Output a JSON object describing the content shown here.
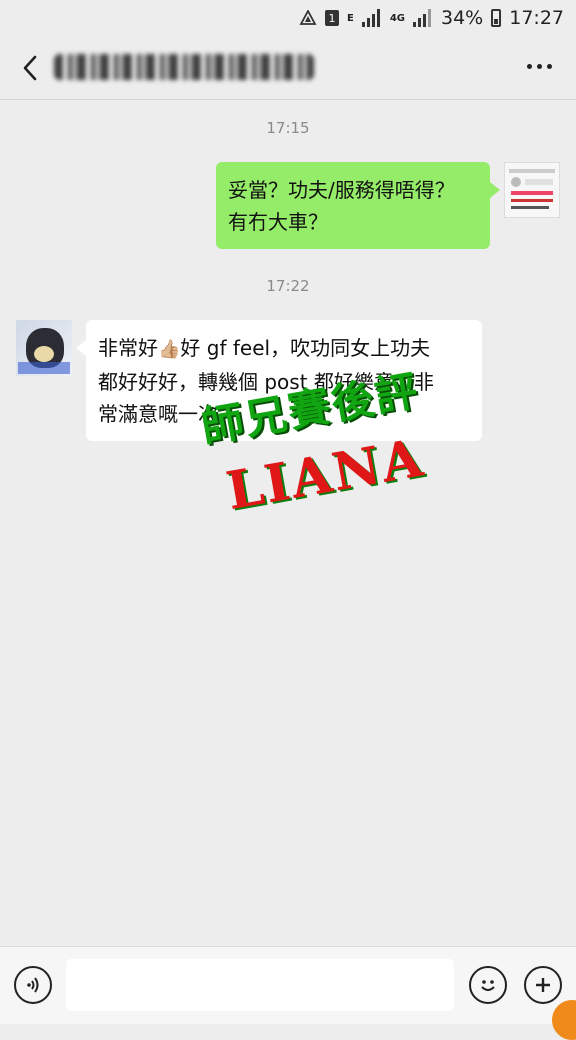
{
  "status_bar": {
    "sim_badge": "1",
    "net_e": "E",
    "net_4g": "4G",
    "battery": "34%",
    "time": "17:27"
  },
  "header": {
    "back_icon": "chevron-left-icon",
    "more_icon": "more-horizontal-icon"
  },
  "messages": [
    {
      "type": "timestamp",
      "text": "17:15"
    },
    {
      "type": "outgoing",
      "text": "妥當？功夫/服務得唔得？\n有冇大車？"
    },
    {
      "type": "timestamp",
      "text": "17:22"
    },
    {
      "type": "incoming",
      "text_before": "非常好",
      "emoji": "👍🏼",
      "text_after": "好 gf feel，吹功同女上功夫\n都好好好，轉幾個 post 都好樂意，非\n常滿意嘅一次"
    }
  ],
  "watermark": {
    "line1": "師兄賽後評",
    "line2": "LIANA",
    "color1": "#11a611",
    "color2": "#e01717"
  },
  "input_bar": {
    "voice_icon": "voice-icon",
    "emoji_icon": "emoji-icon",
    "plus_icon": "plus-icon",
    "input_value": ""
  }
}
